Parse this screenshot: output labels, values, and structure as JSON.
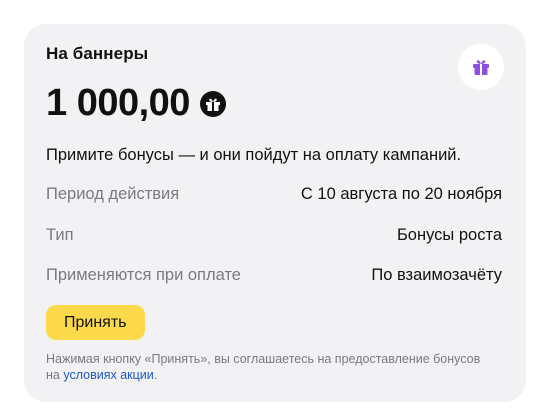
{
  "card": {
    "title": "На баннеры",
    "amount": "1 000,00",
    "amount_icon": "bonus-coin-icon",
    "badge_icon": "gift-icon",
    "description": "Примите бонусы — и они пойдут на оплату кампаний.",
    "rows": [
      {
        "label": "Период действия",
        "value": "С 10 августа по 20 ноября"
      },
      {
        "label": "Тип",
        "value": "Бонусы роста"
      },
      {
        "label": "Применяются при оплате",
        "value": "По взаимозачёту"
      }
    ],
    "accept_label": "Принять",
    "disclaimer_prefix": "Нажимая кнопку «Принять», вы соглашаетесь на предоставление бонусов на ",
    "disclaimer_link": "условиях акции",
    "disclaimer_suffix": "."
  },
  "colors": {
    "card_bg": "#f2f2f4",
    "accent_button": "#fcd94a",
    "gift_purple": "#8e4fe0",
    "link": "#1e55c4",
    "muted_text": "#7a7a7e"
  }
}
